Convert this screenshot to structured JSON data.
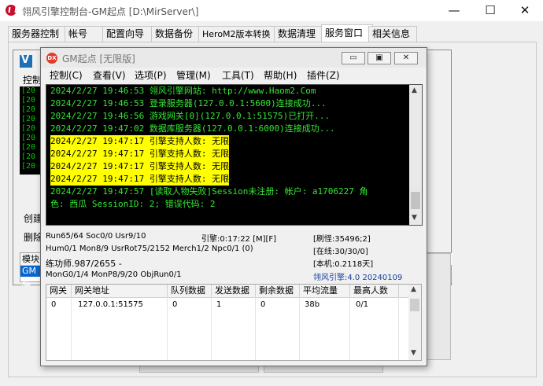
{
  "window": {
    "title": "翎风引擎控制台-GM起点 [D:\\MirServer\\]",
    "min_glyph": "—",
    "max_glyph": "☐",
    "close_glyph": "✕"
  },
  "tabs": [
    {
      "label": "服务器控制"
    },
    {
      "label": "帐号"
    },
    {
      "label": "配置向导"
    },
    {
      "label": "数据备份"
    },
    {
      "label": "HeroM2版本转换"
    },
    {
      "label": "数据清理"
    },
    {
      "label": "服务窗口",
      "active": true
    },
    {
      "label": "相关信息"
    }
  ],
  "background_console": {
    "menu_label": "控制",
    "log_lines": [
      "[20",
      "[20",
      "[20",
      "[20",
      "[20",
      "[20",
      "[20",
      "[20",
      "[20"
    ],
    "label_a": "创建",
    "label_b": "删除",
    "grid_header": "模块",
    "grid_selected": "GM起"
  },
  "console": {
    "icon_text": "DX",
    "title": "GM起点 [无限版]",
    "controls": {
      "min": "▭",
      "max": "▣",
      "close": "✕"
    },
    "menu": [
      "控制(C)",
      "查看(V)",
      "选项(P)",
      "管理(M)",
      "工具(T)",
      "帮助(H)",
      "插件(Z)"
    ],
    "log": [
      {
        "text": "2024/2/27 19:46:53 翎风引擎网站: http://www.Haom2.Com",
        "highlight": false
      },
      {
        "text": "2024/2/27 19:46:53 登录服务器(127.0.0.1:5600)连接成功...",
        "highlight": false
      },
      {
        "text": "2024/2/27 19:46:56 游戏网关[0](127.0.0.1:51575)已打开...",
        "highlight": false
      },
      {
        "text": "2024/2/27 19:47:02 数据库服务器(127.0.0.1:6000)连接成功...",
        "highlight": false
      },
      {
        "text": "2024/2/27 19:47:17 引擎支持人数: 无限",
        "highlight": true
      },
      {
        "text": "2024/2/27 19:47:17 引擎支持人数: 无限",
        "highlight": true
      },
      {
        "text": "2024/2/27 19:47:17 引擎支持人数: 无限",
        "highlight": true
      },
      {
        "text": "2024/2/27 19:47:17 引擎支持人数: 无限",
        "highlight": true
      },
      {
        "text": "2024/2/27 19:47:57 [读取人物失败]Session未注册: 帐户: a1706227 角",
        "highlight": false
      },
      {
        "text": "色: 西瓜 SessionID: 2; 错误代码: 2",
        "highlight": false
      }
    ],
    "stats": {
      "run": "Run65/64 Soc0/0 Usr9/10",
      "engine_time": "引擎:0:17:22 [M][F]",
      "refresh": "[刷怪:35496;2]",
      "hum": "Hum0/1 Mon8/9 UsrRot75/2152 Merch1/2 Npc0/1 (0)",
      "online": "[在线:30/30/0]",
      "practice": "练功师.987/2655 -",
      "local": "[本机:0.2118天]",
      "mon": "MonG0/1/4 MonP8/9/20 ObjRun0/1",
      "version": "翎风引擎:4.0 20240109"
    },
    "gateway_table": {
      "columns": [
        "网关",
        "网关地址",
        "队列数据",
        "发送数据",
        "剩余数据",
        "平均流量",
        "最高人数"
      ],
      "rows": [
        [
          "0",
          "127.0.0.1:51575",
          "0",
          "1",
          "0",
          "38b",
          "0/1"
        ]
      ]
    }
  }
}
